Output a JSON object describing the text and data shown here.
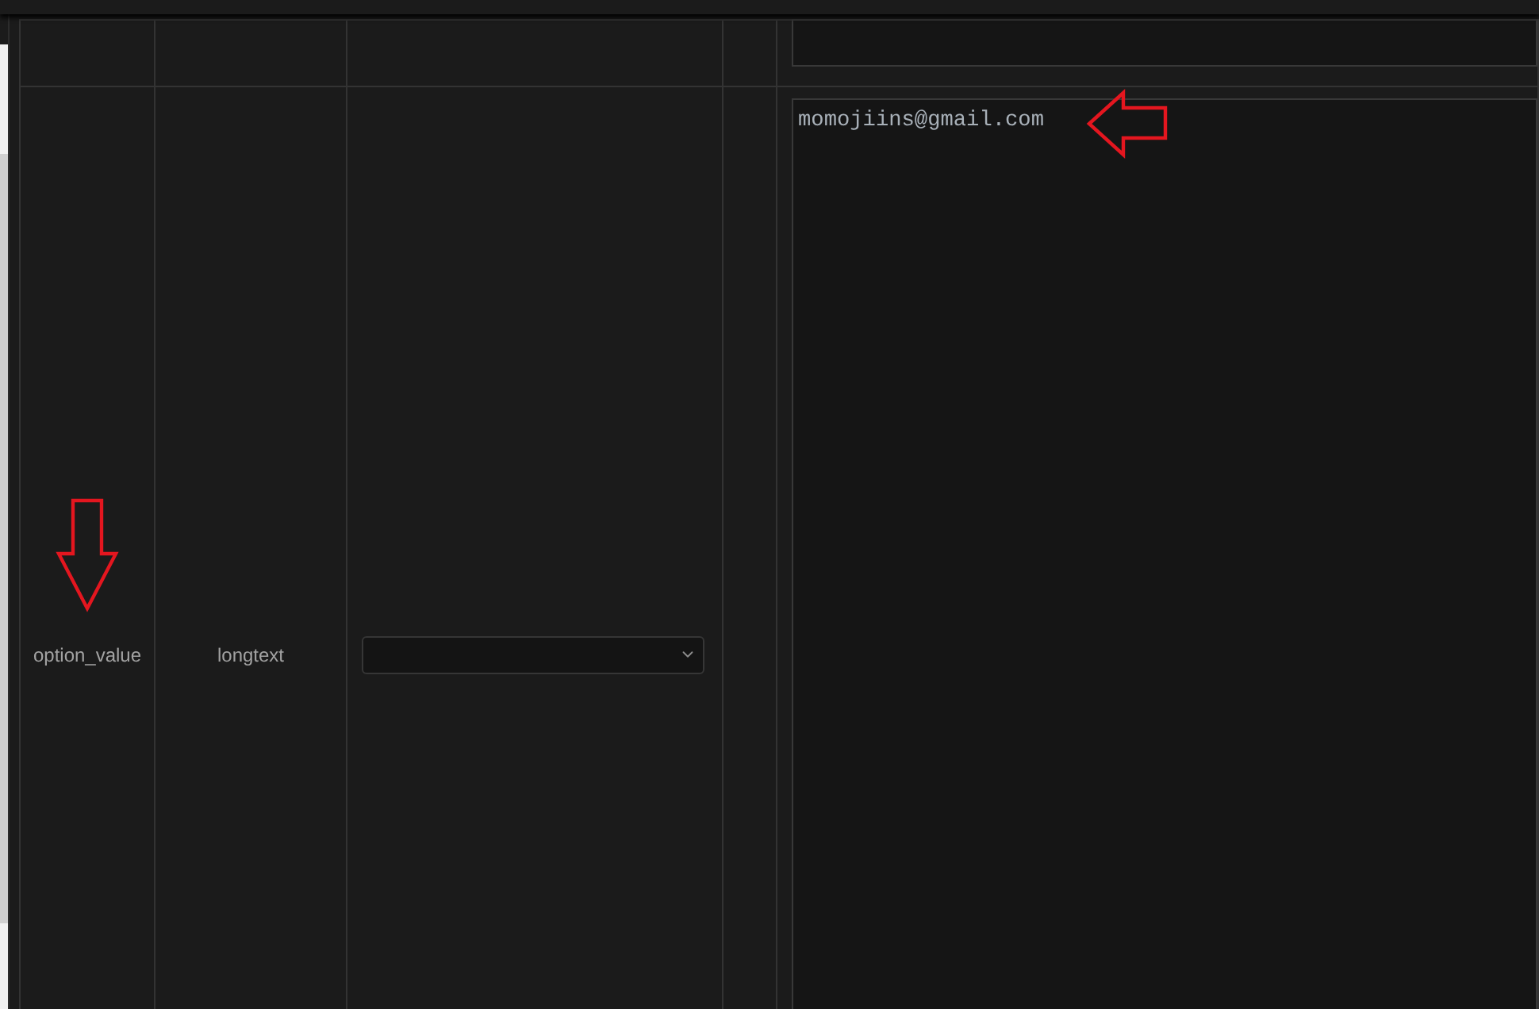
{
  "table": {
    "rows": [
      {
        "cells": [
          {
            "kind": "blank"
          },
          {
            "kind": "blank"
          },
          {
            "kind": "blank"
          },
          {
            "kind": "blank"
          },
          {
            "kind": "textarea"
          }
        ]
      },
      {
        "cells": [
          {
            "kind": "label",
            "text": "option_value",
            "marked": true
          },
          {
            "kind": "label",
            "text": "longtext",
            "marked": false
          },
          {
            "kind": "select"
          },
          {
            "kind": "blank"
          },
          {
            "kind": "textarea",
            "value": "momojiins@gmail.com",
            "marked": true
          }
        ]
      }
    ]
  }
}
